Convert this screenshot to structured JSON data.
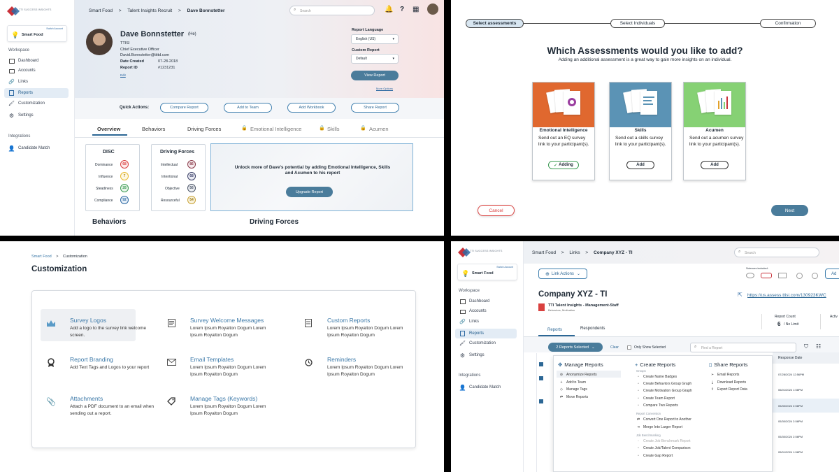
{
  "logo": {
    "brand": "TTI SUCCESS INSIGHTS"
  },
  "account": {
    "switch_label": "Switch Account",
    "name": "Smart Food"
  },
  "sidebar": {
    "workspace_label": "Workspace",
    "items": [
      "Dashboard",
      "Accounts",
      "Links",
      "Reports",
      "Customization",
      "Settings"
    ],
    "integrations_label": "Integrations",
    "integration_items": [
      "Candidate Match"
    ]
  },
  "q1": {
    "breadcrumb": [
      "Smart Food",
      ">",
      "Talent Insights Recruit",
      ">",
      "Dave Bonnstetter"
    ],
    "search_placeholder": "Search",
    "profile": {
      "name": "Dave Bonnstetter",
      "pronoun": "(He)",
      "company": "TTISI",
      "title": "Chief Executive Officer",
      "email": "David.Bonnstetter@ttitd.com",
      "date_created_label": "Date Created",
      "date_created": "07-28-2018",
      "report_id_label": "Report ID",
      "report_id": "#1231231",
      "edit": "Edit"
    },
    "report_language_label": "Report Language",
    "report_language": "English (US)",
    "custom_report_label": "Custom Report",
    "custom_report": "Default",
    "view_report": "View Report",
    "more_options": "More Options",
    "quick_actions_label": "Quick Actions:",
    "quick_actions": [
      "Compare Report",
      "Add to Team",
      "Add Workbook",
      "Share Report"
    ],
    "tabs": [
      "Overview",
      "Behaviors",
      "Driving Forces",
      "Emotional Intelligence",
      "Skills",
      "Acumen"
    ],
    "disc": {
      "title": "DISC",
      "rows": [
        {
          "label": "Dominance",
          "value": "68"
        },
        {
          "label": "Influence",
          "value": "7"
        },
        {
          "label": "Steadiness",
          "value": "28"
        },
        {
          "label": "Compliance",
          "value": "92"
        }
      ]
    },
    "driving_forces": {
      "title": "Driving Forces",
      "rows": [
        {
          "label": "Intellectual",
          "value": "86"
        },
        {
          "label": "Intentional",
          "value": "68"
        },
        {
          "label": "Objective",
          "value": "56"
        },
        {
          "label": "Resourceful",
          "value": "54"
        }
      ]
    },
    "unlock_text": "Unlock more of Dave's potential by adding Emotional Intelligence, Skills and Acumen to his report",
    "upgrade": "Upgrade Report",
    "section_behaviors": "Behaviors",
    "section_driving_forces": "Driving Forces"
  },
  "q2": {
    "steps": [
      "Select assessments",
      "Select Individuals",
      "Confirmation"
    ],
    "title": "Which Assessments would you like to add?",
    "subtitle": "Adding an additional assessment is a great way to gain more insights on an individual.",
    "cards": [
      {
        "title": "Emotional Intelligence",
        "desc": "Send out an EQ survey link to your participant(s).",
        "button": "Adding",
        "color": "#e0682f"
      },
      {
        "title": "Skills",
        "desc": "Send out a skills survey link to your participant(s).",
        "button": "Add",
        "color": "#5b93b5"
      },
      {
        "title": "Acumen",
        "desc": "Send out a acumen survey link to your participant(s).",
        "button": "Add",
        "color": "#86d174"
      }
    ],
    "cancel": "Cancel",
    "next": "Next"
  },
  "q3": {
    "breadcrumb": [
      "Smart Food",
      ">",
      "Customization"
    ],
    "title": "Customization",
    "items": [
      {
        "title": "Survey Logos",
        "desc": "Add a logo to the survey link welcome screen.",
        "icon": "crown-icon"
      },
      {
        "title": "Survey Welcome Messages",
        "desc": "Lorem Ipsum Royalton Dogum Lorem Ipsum Royalton Dogum",
        "icon": "document-icon"
      },
      {
        "title": "Custom Reports",
        "desc": "Lorem Ipsum Royalton Dogum Lorem Ipsum Royalton Dogum",
        "icon": "report-icon"
      },
      {
        "title": "Report Branding",
        "desc": "Add Text Tags and Logos to your report",
        "icon": "award-icon"
      },
      {
        "title": "Email Templates",
        "desc": "Lorem Ipsum Royalton Dogum Lorem Ipsum Royalton Dogum",
        "icon": "mail-icon"
      },
      {
        "title": "Reminders",
        "desc": "Lorem Ipsum Royalton Dogum Lorem Ipsum Royalton Dogum",
        "icon": "clock-icon"
      },
      {
        "title": "Attachments",
        "desc": "Attach a PDF document to an email when sending out a report.",
        "icon": "paperclip-icon"
      },
      {
        "title": "Manage Tags (Keywords)",
        "desc": "Lorem Ipsum Royalton Dogum Lorem Ipsum Royalton Dogum",
        "icon": "tag-icon"
      }
    ]
  },
  "q4": {
    "breadcrumb": [
      "Smart Food",
      ">",
      "Links",
      ">",
      "Company XYZ - TI"
    ],
    "search_placeholder": "Search",
    "link_actions": "Link Actions",
    "sciences_label": "Sciences included:",
    "add_label": "Ad",
    "company_title": "Company XYZ - TI",
    "report_name": "TTI Talent Insights - Management-Staff",
    "report_sub": "Behaviors, Motivation",
    "link_url": "https://us.assess.ttisi.com/130923KWC",
    "report_count_label": "Report Count",
    "report_count": "6",
    "report_limit": "/ No Limit",
    "active_label": "Activ",
    "tabs": [
      "Reports",
      "Respondents"
    ],
    "selected_btn": "2 Reports Selected",
    "clear": "Clear",
    "only_selected": "Only Show Selected",
    "find_placeholder": "Find a Report",
    "response_date": "Response Date",
    "dates": [
      "07/28/2024 12:56PM",
      "06/01/2024 1:56PM",
      "05/30/2024 2:56PM",
      "05/30/2024 2:56PM",
      "05/30/2024 2:56PM",
      "05/01/2024 1:56PM"
    ],
    "manage": {
      "title": "Manage Reports",
      "items": [
        "Anonymize Reports",
        "Add to Team",
        "Manage Tags",
        "Move Reports"
      ]
    },
    "create": {
      "title": "Create Reports",
      "groups_label": "Groups",
      "groups": [
        "Create Name Badges",
        "Create Behaviors Group Graph",
        "Create Motivation Group Graph",
        "Create Team Report",
        "Compare Two Reports"
      ],
      "conversion_label": "Report Conversion",
      "conversion": [
        "Convert One Report to Another",
        "Merge Into Larger Report"
      ],
      "bench_label": "Job Benchmarking",
      "bench": [
        "Create Job Benchmark Report",
        "Create Job/Talent Comparison",
        "Create Gap Report"
      ]
    },
    "share": {
      "title": "Share Reports",
      "items": [
        "Email Reports",
        "Download Reports",
        "Export Report Data"
      ]
    }
  }
}
